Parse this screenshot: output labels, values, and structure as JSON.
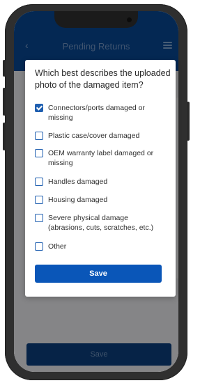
{
  "header": {
    "title": "Pending Returns",
    "back_icon": "chevron-left-icon",
    "menu_icon": "hamburger-menu-icon"
  },
  "dialog": {
    "question": "Which best describes the uploaded photo of the damaged item?",
    "options": [
      {
        "label": "Connectors/ports damaged or missing",
        "checked": true
      },
      {
        "label": "Plastic case/cover damaged",
        "checked": false
      },
      {
        "label": "OEM warranty label damaged or missing",
        "checked": false
      },
      {
        "label": "Handles damaged",
        "checked": false
      },
      {
        "label": "Housing damaged",
        "checked": false
      },
      {
        "label": "Severe physical damage (abrasions, cuts, scratches, etc.)",
        "checked": false
      },
      {
        "label": "Other",
        "checked": false
      }
    ],
    "save_label": "Save"
  },
  "background": {
    "save_label": "Save"
  },
  "colors": {
    "brand": "#08468f",
    "accent": "#0a56b8",
    "checkbox": "#1f5fb0"
  }
}
